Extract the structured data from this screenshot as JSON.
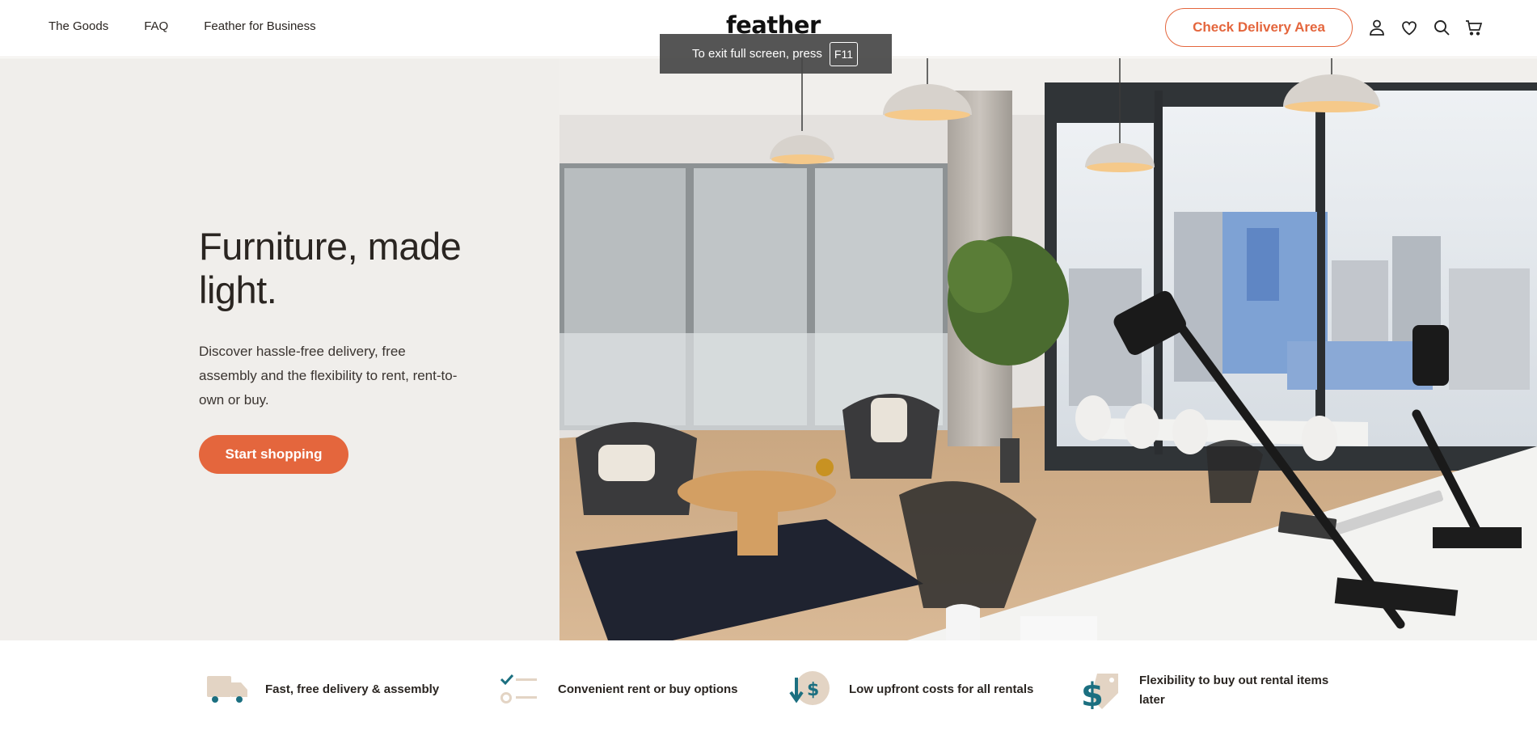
{
  "nav": {
    "items": [
      "The Goods",
      "FAQ",
      "Feather for Business"
    ]
  },
  "brand": {
    "logo": "feather"
  },
  "header": {
    "cta_label": "Check Delivery Area",
    "icons": [
      "account-icon",
      "heart-icon",
      "search-icon",
      "cart-icon"
    ]
  },
  "toast": {
    "message": "To exit full screen, press",
    "key": "F11"
  },
  "hero": {
    "title": "Furniture, made light.",
    "subtitle": "Discover hassle-free delivery, free assembly and the flexibility to rent, rent-to-own or buy.",
    "button_label": "Start shopping"
  },
  "features": [
    {
      "icon": "truck-icon",
      "label": "Fast, free delivery & assembly"
    },
    {
      "icon": "checklist-icon",
      "label": "Convenient rent or buy options"
    },
    {
      "icon": "low-cost-icon",
      "label": "Low upfront costs for all rentals"
    },
    {
      "icon": "price-tag-icon",
      "label": "Flexibility to buy out rental items later"
    }
  ],
  "colors": {
    "accent": "#e4663d",
    "hero_bg": "#f0eeeb",
    "teal": "#1b6f80",
    "tan": "#e3d4c4"
  }
}
